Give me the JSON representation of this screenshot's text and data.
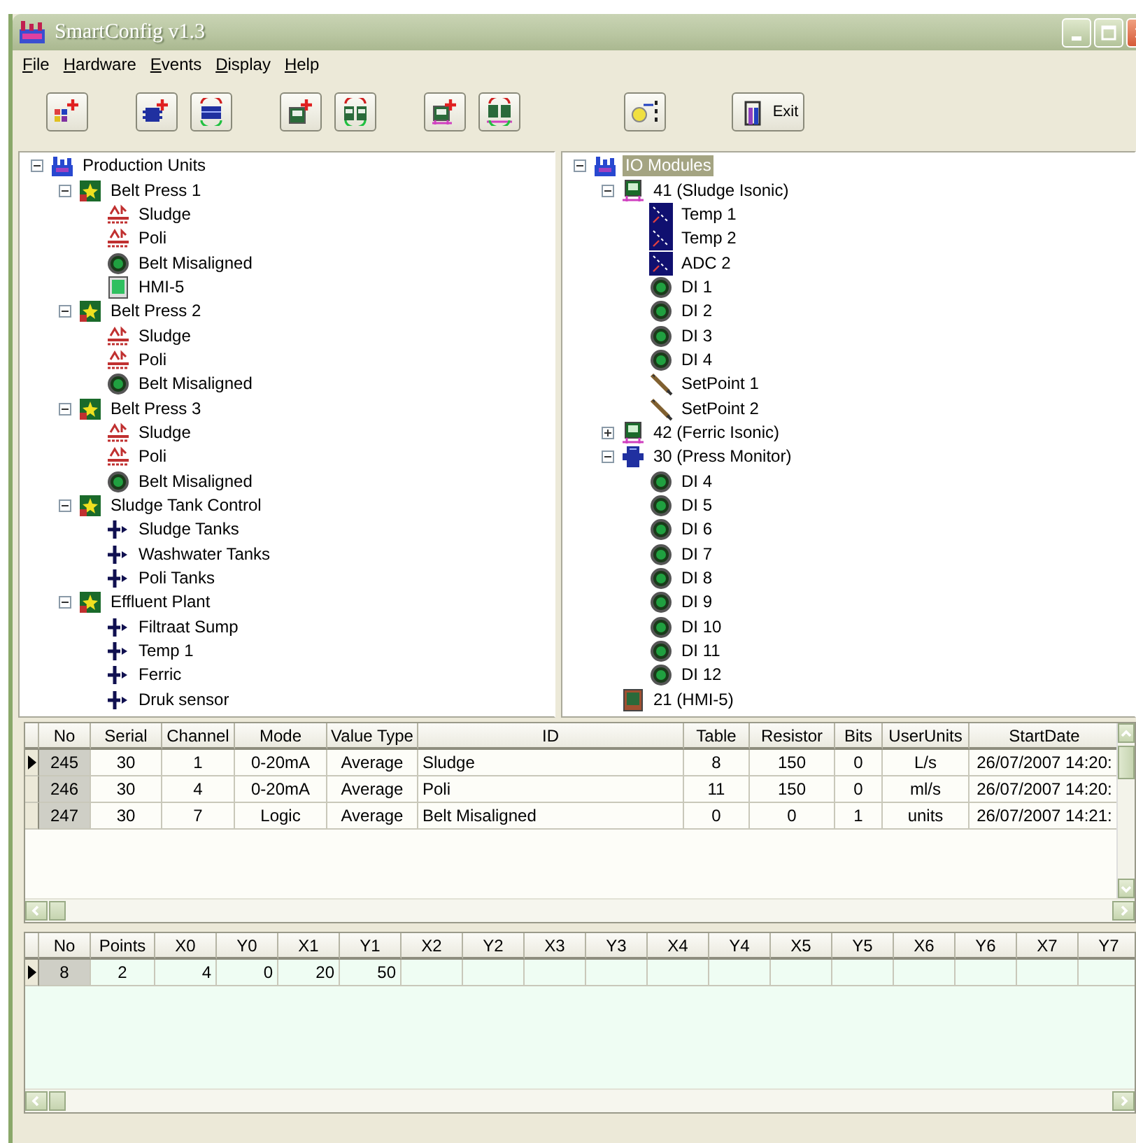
{
  "window": {
    "title": "SmartConfig v1.3"
  },
  "menu": [
    "File",
    "Hardware",
    "Events",
    "Display",
    "Help"
  ],
  "toolbar": [
    [
      {
        "kind": "add-unit"
      }
    ],
    [
      {
        "kind": "add-hardware"
      },
      {
        "kind": "sync-hardware"
      }
    ],
    [
      {
        "kind": "add-panel"
      },
      {
        "kind": "sync-panel"
      }
    ],
    [
      {
        "kind": "add-module"
      },
      {
        "kind": "sync-module"
      }
    ],
    [
      {
        "kind": "wizard"
      }
    ],
    [
      {
        "kind": "exit",
        "label": "Exit"
      }
    ]
  ],
  "production_tree": {
    "label": "Production Units",
    "kind": "factory",
    "expanded": true,
    "selected": false,
    "children": [
      {
        "label": "Belt Press 1",
        "kind": "unit",
        "expanded": true,
        "selected": false,
        "children": [
          {
            "label": "Sludge",
            "kind": "analog",
            "selected": false
          },
          {
            "label": "Poli",
            "kind": "analog",
            "selected": false
          },
          {
            "label": "Belt Misaligned",
            "kind": "led",
            "selected": false
          },
          {
            "label": "HMI-5",
            "kind": "hmi",
            "selected": false
          }
        ]
      },
      {
        "label": "Belt Press 2",
        "kind": "unit",
        "expanded": true,
        "selected": false,
        "children": [
          {
            "label": "Sludge",
            "kind": "analog",
            "selected": false
          },
          {
            "label": "Poli",
            "kind": "analog",
            "selected": false
          },
          {
            "label": "Belt Misaligned",
            "kind": "led",
            "selected": false
          }
        ]
      },
      {
        "label": "Belt Press 3",
        "kind": "unit",
        "expanded": true,
        "selected": false,
        "children": [
          {
            "label": "Sludge",
            "kind": "analog",
            "selected": false
          },
          {
            "label": "Poli",
            "kind": "analog",
            "selected": false
          },
          {
            "label": "Belt Misaligned",
            "kind": "led",
            "selected": false
          }
        ]
      },
      {
        "label": "Sludge Tank Control",
        "kind": "unit",
        "expanded": true,
        "selected": false,
        "children": [
          {
            "label": "Sludge Tanks",
            "kind": "valve",
            "selected": false
          },
          {
            "label": "Washwater Tanks",
            "kind": "valve",
            "selected": false
          },
          {
            "label": "Poli Tanks",
            "kind": "valve",
            "selected": false
          }
        ]
      },
      {
        "label": "Effluent Plant",
        "kind": "unit",
        "expanded": true,
        "selected": false,
        "children": [
          {
            "label": "Filtraat Sump",
            "kind": "valve",
            "selected": false
          },
          {
            "label": "Temp 1",
            "kind": "valve",
            "selected": false
          },
          {
            "label": "Ferric",
            "kind": "valve",
            "selected": false
          },
          {
            "label": "Druk sensor",
            "kind": "valve",
            "selected": false
          }
        ]
      }
    ]
  },
  "io_tree": {
    "label": "IO Modules",
    "kind": "factory",
    "expanded": true,
    "selected": true,
    "children": [
      {
        "label": "41 (Sludge Isonic)",
        "kind": "module",
        "expanded": true,
        "selected": false,
        "children": [
          {
            "label": "Temp 1",
            "kind": "sensor",
            "selected": false
          },
          {
            "label": "Temp 2",
            "kind": "sensor",
            "selected": false
          },
          {
            "label": "ADC 2",
            "kind": "sensor",
            "selected": false
          },
          {
            "label": "DI 1",
            "kind": "led",
            "selected": false
          },
          {
            "label": "DI 2",
            "kind": "led",
            "selected": false
          },
          {
            "label": "DI 3",
            "kind": "led",
            "selected": false
          },
          {
            "label": "DI 4",
            "kind": "led",
            "selected": false
          },
          {
            "label": "SetPoint 1",
            "kind": "pencil",
            "selected": false
          },
          {
            "label": "SetPoint 2",
            "kind": "pencil",
            "selected": false
          }
        ]
      },
      {
        "label": "42 (Ferric Isonic)",
        "kind": "module",
        "expanded": false,
        "selected": false
      },
      {
        "label": "30 (Press Monitor)",
        "kind": "chip",
        "expanded": true,
        "selected": false,
        "children": [
          {
            "label": "DI 4",
            "kind": "led",
            "selected": false
          },
          {
            "label": "DI 5",
            "kind": "led",
            "selected": false
          },
          {
            "label": "DI 6",
            "kind": "led",
            "selected": false
          },
          {
            "label": "DI 7",
            "kind": "led",
            "selected": false
          },
          {
            "label": "DI 8",
            "kind": "led",
            "selected": false
          },
          {
            "label": "DI 9",
            "kind": "led",
            "selected": false
          },
          {
            "label": "DI 10",
            "kind": "led",
            "selected": false
          },
          {
            "label": "DI 11",
            "kind": "led",
            "selected": false
          },
          {
            "label": "DI 12",
            "kind": "led",
            "selected": false
          }
        ]
      },
      {
        "label": "21 (HMI-5)",
        "kind": "panel",
        "selected": false
      }
    ]
  },
  "channels_table": {
    "columns": [
      "No",
      "Serial",
      "Channel",
      "Mode",
      "Value Type",
      "ID",
      "Table",
      "Resistor",
      "Bits",
      "UserUnits",
      "StartDate"
    ],
    "rows": [
      {
        "selected": true,
        "cells": [
          "245",
          "30",
          "1",
          "0-20mA",
          "Average",
          "Sludge",
          "8",
          "150",
          "0",
          "L/s",
          "26/07/2007 14:20:"
        ]
      },
      {
        "selected": false,
        "cells": [
          "246",
          "30",
          "4",
          "0-20mA",
          "Average",
          "Poli",
          "11",
          "150",
          "0",
          "ml/s",
          "26/07/2007 14:20:"
        ]
      },
      {
        "selected": false,
        "cells": [
          "247",
          "30",
          "7",
          "Logic",
          "Average",
          "Belt Misaligned",
          "0",
          "0",
          "1",
          "units",
          "26/07/2007 14:21:"
        ]
      }
    ]
  },
  "points_table": {
    "columns": [
      "No",
      "Points",
      "X0",
      "Y0",
      "X1",
      "Y1",
      "X2",
      "Y2",
      "X3",
      "Y3",
      "X4",
      "Y4",
      "X5",
      "Y5",
      "X6",
      "Y6",
      "X7",
      "Y7"
    ],
    "rows": [
      {
        "selected": true,
        "cells": [
          "8",
          "2",
          "4",
          "0",
          "20",
          "50"
        ]
      }
    ]
  }
}
